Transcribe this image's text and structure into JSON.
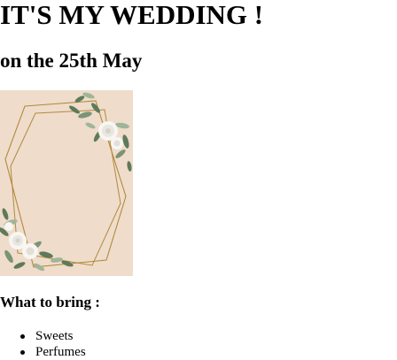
{
  "heading": "IT'S MY WEDDING !",
  "subheading": "on the 25th May",
  "invitation_image": {
    "alt": "wedding invitation card",
    "colors": {
      "background": "#f1dfcf",
      "frame": "#b28a3d",
      "leaf": "#5e7a5a",
      "leaf_light": "#9fb59a",
      "flower": "#f7f6f3"
    }
  },
  "bring_heading": "What to bring :",
  "bring_items": [
    {
      "label": "Sweets"
    },
    {
      "label": "Perfumes"
    }
  ]
}
